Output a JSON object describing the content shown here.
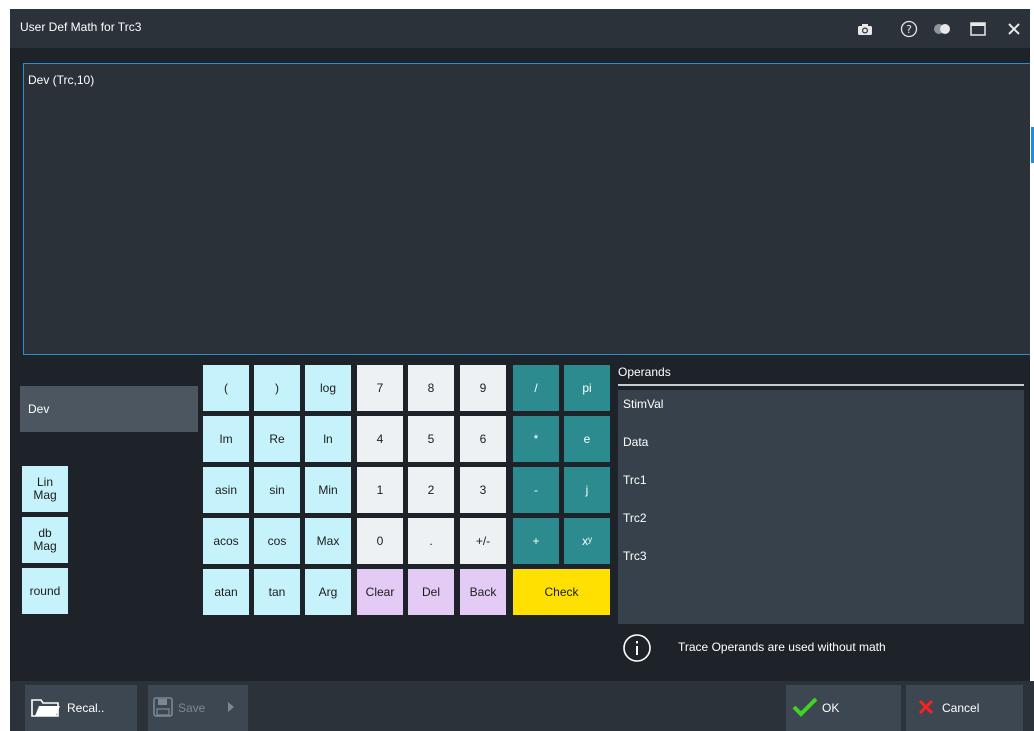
{
  "window": {
    "title": "User Def Math for Trc3"
  },
  "titlebar_icons": [
    "camera-icon",
    "help-icon",
    "toggle-icon",
    "maximize-icon",
    "close-icon"
  ],
  "editor": {
    "expression": "Dev (Trc,10)"
  },
  "functions": {
    "dev": "Dev",
    "lin_mag": "Lin\nMag",
    "db_mag": "db\nMag",
    "round": "round"
  },
  "keypad": {
    "row1": [
      "(",
      ")",
      "log",
      "7",
      "8",
      "9",
      "/",
      "pi"
    ],
    "row2": [
      "Im",
      "Re",
      "ln",
      "4",
      "5",
      "6",
      "*",
      "e"
    ],
    "row3": [
      "asin",
      "sin",
      "Min",
      "1",
      "2",
      "3",
      "-",
      "j"
    ],
    "row4": [
      "acos",
      "cos",
      "Max",
      "0",
      ".",
      "+/-",
      "+",
      "xʸ"
    ],
    "row5": [
      "atan",
      "tan",
      "Arg",
      "Clear",
      "Del",
      "Back",
      "Check"
    ]
  },
  "operands": {
    "label": "Operands",
    "items": [
      "StimVal",
      "Data",
      "Trc1",
      "Trc2",
      "Trc3"
    ]
  },
  "info": {
    "text": "Trace Operands are used without math"
  },
  "bottom": {
    "recall": "Recal..",
    "save": "Save",
    "ok": "OK",
    "cancel": "Cancel"
  },
  "colors": {
    "background": "#1d2329",
    "accent": "#2a8fd0",
    "cyan_key": "#c6f3fb",
    "teal_key": "#2c8b8e",
    "clear_key": "#e3cbf6",
    "check_key": "#ffe000",
    "ok_check": "#3fd424",
    "cancel_x": "#ff2020"
  }
}
